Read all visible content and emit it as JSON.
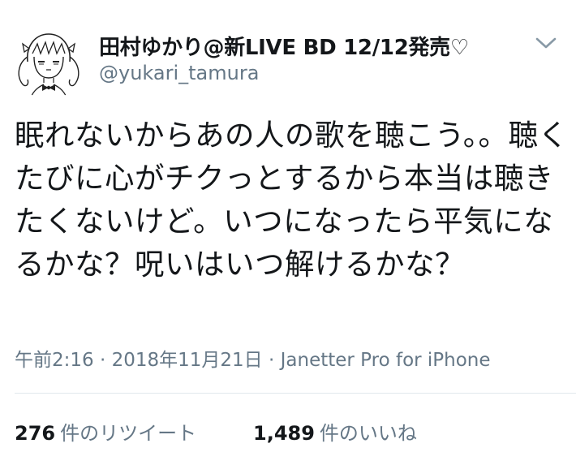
{
  "tweet": {
    "author": {
      "display_name": "田村ゆかり@新LIVE BD 12/12発売♡",
      "handle": "@yukari_tamura",
      "avatar_icon": "avatar-illustration-icon"
    },
    "menu_icon": "chevron-down-icon",
    "text": "眠れないからあの人の歌を聴こう。。聴くたびに心がチクっとするから本当は聴きたくないけど。いつになったら平気になるかな？呪いはいつ解けるかな？",
    "meta": {
      "time": "午前2:16",
      "separator1": " · ",
      "date": "2018年11月21日",
      "separator2": " · ",
      "client": "Janetter Pro for iPhone"
    },
    "stats": {
      "retweets": {
        "count": "276",
        "label": "件のリツイート"
      },
      "likes": {
        "count": "1,489",
        "label": "件のいいね"
      }
    }
  },
  "colors": {
    "text_primary": "#14171a",
    "text_secondary": "#657786",
    "divider": "#e1e8ed",
    "background": "#ffffff"
  }
}
